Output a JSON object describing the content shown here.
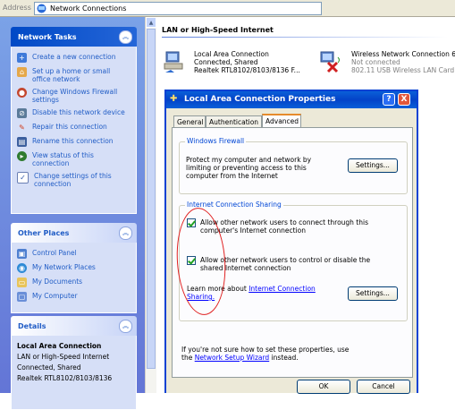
{
  "address_bar": {
    "label": "Address",
    "value": "Network Connections"
  },
  "network_tasks": {
    "title": "Network Tasks",
    "items": [
      {
        "label": "Create a new connection",
        "icon": "new-connection-icon"
      },
      {
        "label": "Set up a home or small office network",
        "icon": "home-network-icon"
      },
      {
        "label": "Change Windows Firewall settings",
        "icon": "firewall-icon"
      },
      {
        "label": "Disable this network device",
        "icon": "disable-device-icon"
      },
      {
        "label": "Repair this connection",
        "icon": "repair-icon"
      },
      {
        "label": "Rename this connection",
        "icon": "rename-icon"
      },
      {
        "label": "View status of this connection",
        "icon": "status-icon"
      },
      {
        "label": "Change settings of this connection",
        "icon": "settings-icon"
      }
    ]
  },
  "other_places": {
    "title": "Other Places",
    "items": [
      {
        "label": "Control Panel",
        "icon": "control-panel-icon"
      },
      {
        "label": "My Network Places",
        "icon": "network-places-icon"
      },
      {
        "label": "My Documents",
        "icon": "documents-icon"
      },
      {
        "label": "My Computer",
        "icon": "computer-icon"
      }
    ]
  },
  "details": {
    "title": "Details",
    "name": "Local Area Connection",
    "lines": [
      "LAN or High-Speed Internet",
      "Connected, Shared",
      "Realtek RTL8102/8103/8136"
    ]
  },
  "main": {
    "group_title": "LAN or High-Speed Internet",
    "connections": [
      {
        "name": "Local Area Connection",
        "status": "Connected, Shared",
        "device": "Realtek RTL8102/8103/8136 F..."
      },
      {
        "name": "Wireless Network Connection 6",
        "status": "Not connected",
        "device": "802.11 USB Wireless LAN Card"
      }
    ]
  },
  "dialog": {
    "title": "Local Area Connection Properties",
    "help_label": "?",
    "close_label": "X",
    "tabs": [
      "General",
      "Authentication",
      "Advanced"
    ],
    "active_tab": "Advanced",
    "firewall": {
      "legend": "Windows Firewall",
      "text": "Protect my computer and network by limiting or preventing access to this computer from the Internet",
      "button": "Settings..."
    },
    "ics": {
      "legend": "Internet Connection Sharing",
      "option1": "Allow other network users to connect through this computer's Internet connection",
      "option2": "Allow other network users to control or disable the shared Internet connection",
      "learn_prefix": "Learn more about",
      "learn_link": "Internet Connection Sharing.",
      "button": "Settings..."
    },
    "footer_text": "If you're not sure how to set these properties, use the",
    "footer_link": "Network Setup Wizard",
    "footer_suffix": "instead.",
    "ok": "OK",
    "cancel": "Cancel"
  },
  "colors": {
    "accent": "#0842d3",
    "annotation": "#e02020"
  }
}
